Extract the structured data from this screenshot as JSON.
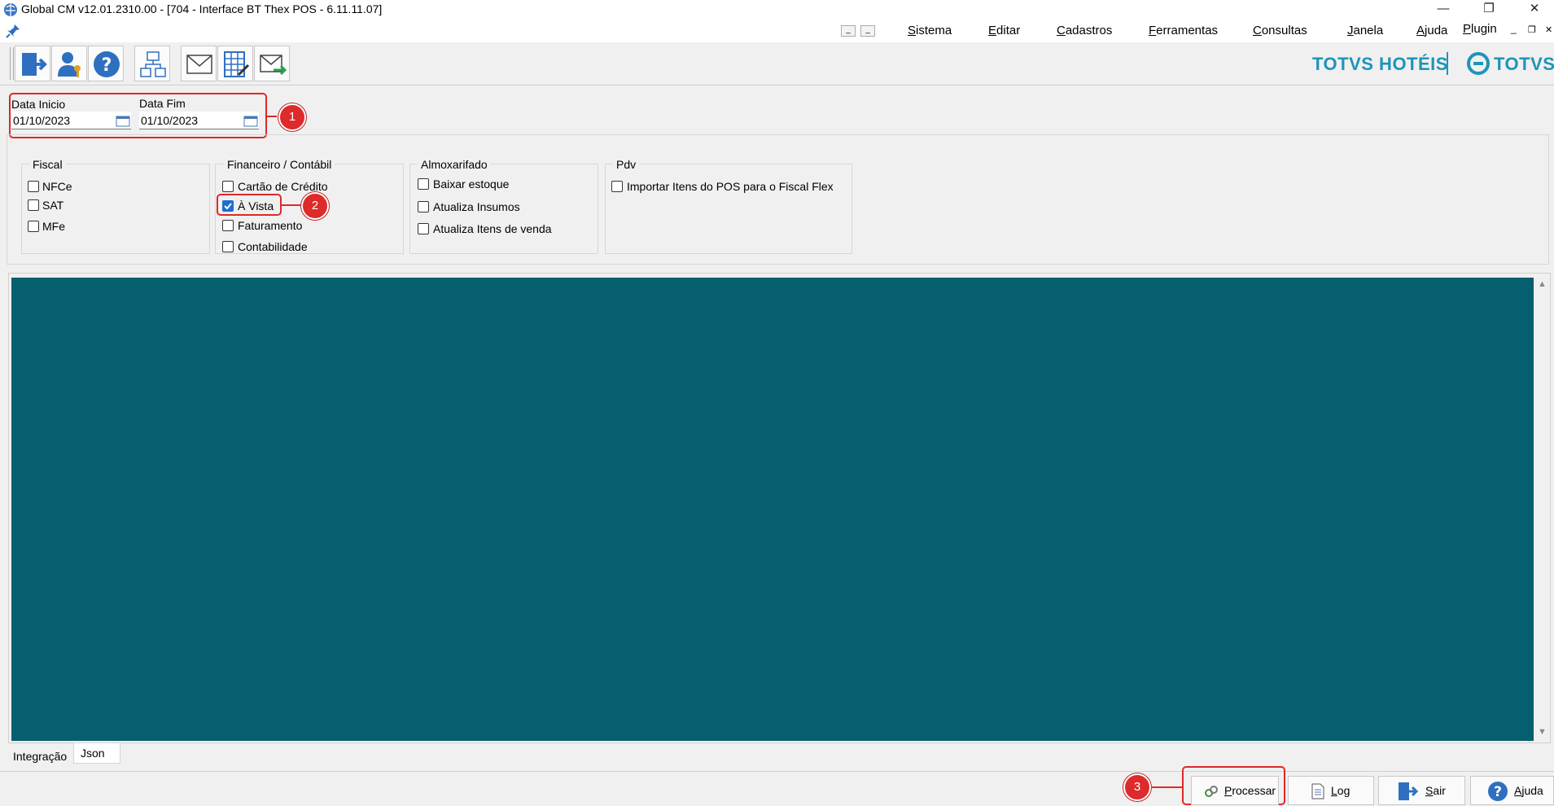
{
  "window": {
    "title": "Global CM v12.01.2310.00 - [704 - Interface BT Thex POS - 6.11.11.07]",
    "controls": {
      "minimize": "—",
      "restore": "❐",
      "close": "✕"
    }
  },
  "menu": {
    "items": [
      "Sistema",
      "Editar",
      "Cadastros",
      "Ferramentas",
      "Consultas",
      "Janela",
      "Ajuda",
      "Plugin"
    ]
  },
  "toolbar": {
    "icons": [
      "exit-door-icon",
      "user-key-icon",
      "help-icon",
      "hierarchy-icon",
      "mail-icon",
      "calculator-icon",
      "mail-forward-icon"
    ]
  },
  "brand": {
    "left": "TOTVS HOTÉIS",
    "right": "TOTVS",
    "color": "#1e94b8"
  },
  "dates": {
    "start_label": "Data Inicio",
    "start_value": "01/10/2023",
    "end_label": "Data Fim",
    "end_value": "01/10/2023"
  },
  "annotations": {
    "one": "1",
    "two": "2",
    "three": "3",
    "color": "#e02828"
  },
  "groups": {
    "fiscal": {
      "title": "Fiscal",
      "items": [
        {
          "label": "NFCe",
          "checked": false
        },
        {
          "label": "SAT",
          "checked": false
        },
        {
          "label": "MFe",
          "checked": false
        }
      ]
    },
    "financeiro": {
      "title": "Financeiro / Contábil",
      "items": [
        {
          "label": "Cartão de Crédito",
          "checked": false
        },
        {
          "label": "À Vista",
          "checked": true
        },
        {
          "label": "Faturamento",
          "checked": false
        },
        {
          "label": "Contabilidade",
          "checked": false
        }
      ]
    },
    "almox": {
      "title": "Almoxarifado",
      "items": [
        {
          "label": "Baixar estoque",
          "checked": false
        },
        {
          "label": "Atualiza Insumos",
          "checked": false
        },
        {
          "label": "Atualiza Itens de venda",
          "checked": false
        }
      ]
    },
    "pdv": {
      "title": "Pdv",
      "items": [
        {
          "label": "Importar Itens do POS para o Fiscal Flex",
          "checked": false
        }
      ]
    }
  },
  "main": {
    "panel_color": "#065f6e"
  },
  "tabs": [
    "Integração",
    "Json"
  ],
  "buttons": {
    "processar": "Processar",
    "log": "Log",
    "sair": "Sair",
    "ajuda": "Ajuda"
  }
}
